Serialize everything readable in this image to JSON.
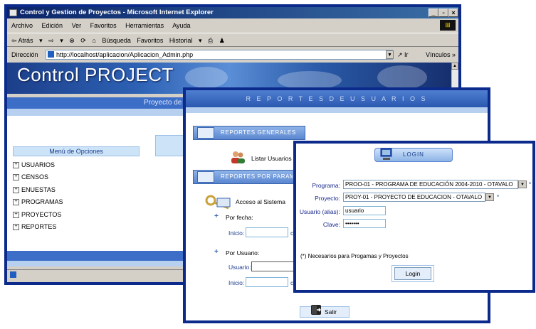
{
  "browser": {
    "title": "Control y Gestion de Proyectos - Microsoft Internet Explorer",
    "window_buttons": [
      "_",
      "▫",
      "×"
    ],
    "menu": [
      "Archivo",
      "Edición",
      "Ver",
      "Favoritos",
      "Herramientas",
      "Ayuda"
    ],
    "toolbar": [
      "⇦ Atrás",
      "▾",
      "⇨",
      "▾",
      "⊗",
      "⟳",
      "⌂",
      "Búsqueda",
      "Favoritos",
      "Historial",
      "▾"
    ],
    "address_label": "Dirección",
    "address_value": "http://localhost/aplicacion/Aplicacion_Admin.php",
    "go_label": "Ir",
    "links_label": "Vínculos",
    "links_more": "»"
  },
  "page": {
    "banner_title": "Control PROJECT",
    "bar_text": "Proyecto de",
    "menu_header": "Menú de Opciones",
    "menu_items": [
      "USUARIOS",
      "CENSOS",
      "ENUESTAS",
      "PROGRAMAS",
      "PROYECTOS",
      "REPORTES"
    ]
  },
  "reportes": {
    "header": "R E P O R T E S D E U S U A R I O S",
    "section_general": "REPORTES GENERALES",
    "listar_usuarios": "Listar Usuarios",
    "section_param": "REPORTES POR PARAMET",
    "acceso": "Acceso al Sistema",
    "por_fecha": "Por fecha:",
    "inicio": "Inicio:",
    "inicio_suffix": "c",
    "por_usuario": "Por Usuario:",
    "usuario": "Usuario:",
    "inicio2": "Inicio:",
    "inicio2_suffix": "c",
    "salir": "Salir",
    "bullet": "+"
  },
  "login": {
    "title": "LOGIN",
    "programa_label": "Programa:",
    "programa_value": "PROO-01 - PROGRAMA DE EDUCACIÓN 2004-2010 - OTAVALO",
    "proyecto_label": "Proyecto:",
    "proyecto_value": "PROY-01 - PROYECTO DE EDUCACION - OTAVALO",
    "usuario_label": "Usuario (alias):",
    "usuario_value": "usuario",
    "clave_label": "Clave:",
    "clave_value": "•••••••",
    "required_mark": "*",
    "note": "(*) Necesarios para Progamas y Proyectos",
    "button": "Login"
  },
  "colors": {
    "window_frame": "#0b2a8c",
    "bar_blue": "#3d6ec7",
    "bar_light": "#b8d0ef"
  }
}
